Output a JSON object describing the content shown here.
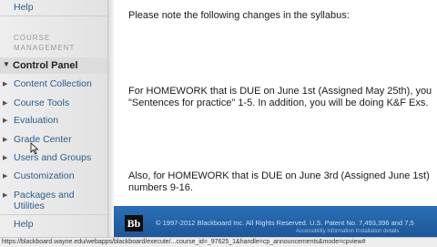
{
  "sidebar": {
    "help_top": "Help",
    "section_header_line1": "COURSE",
    "section_header_line2": "MANAGEMENT",
    "control_panel": "Control Panel",
    "items": [
      {
        "label": "Content Collection"
      },
      {
        "label": "Course Tools"
      },
      {
        "label": "Evaluation"
      },
      {
        "label": "Grade Center"
      },
      {
        "label": "Users and Groups"
      },
      {
        "label": "Customization"
      },
      {
        "label": "Packages and Utilities"
      }
    ],
    "help_bottom": "Help"
  },
  "content": {
    "line1": "Please note the following changes in the syllabus:",
    "line2": "For HOMEWORK that is DUE on June 1st (Assigned May 25th), you",
    "line3": "\"Sentences for practice\" 1-5. In addition, you will be doing K&F Exs.",
    "line4": "Also, for HOMEWORK that is DUE on June 3rd (Assigned June 1st)",
    "line5": "numbers 9-16."
  },
  "footer": {
    "logo_text": "Bb",
    "copyright": "© 1997-2012 Blackboard Inc. All Rights Reserved. U.S. Patent No. 7,493,396 and 7,5",
    "copyright_small": "Accessibility information   Installation details"
  },
  "status_bar": {
    "url": "https://blackboard.wayne.edu/webapps/blackboard/execute/...course_id=_97625_1&handle=cp_announcements&mode=cpview#"
  }
}
